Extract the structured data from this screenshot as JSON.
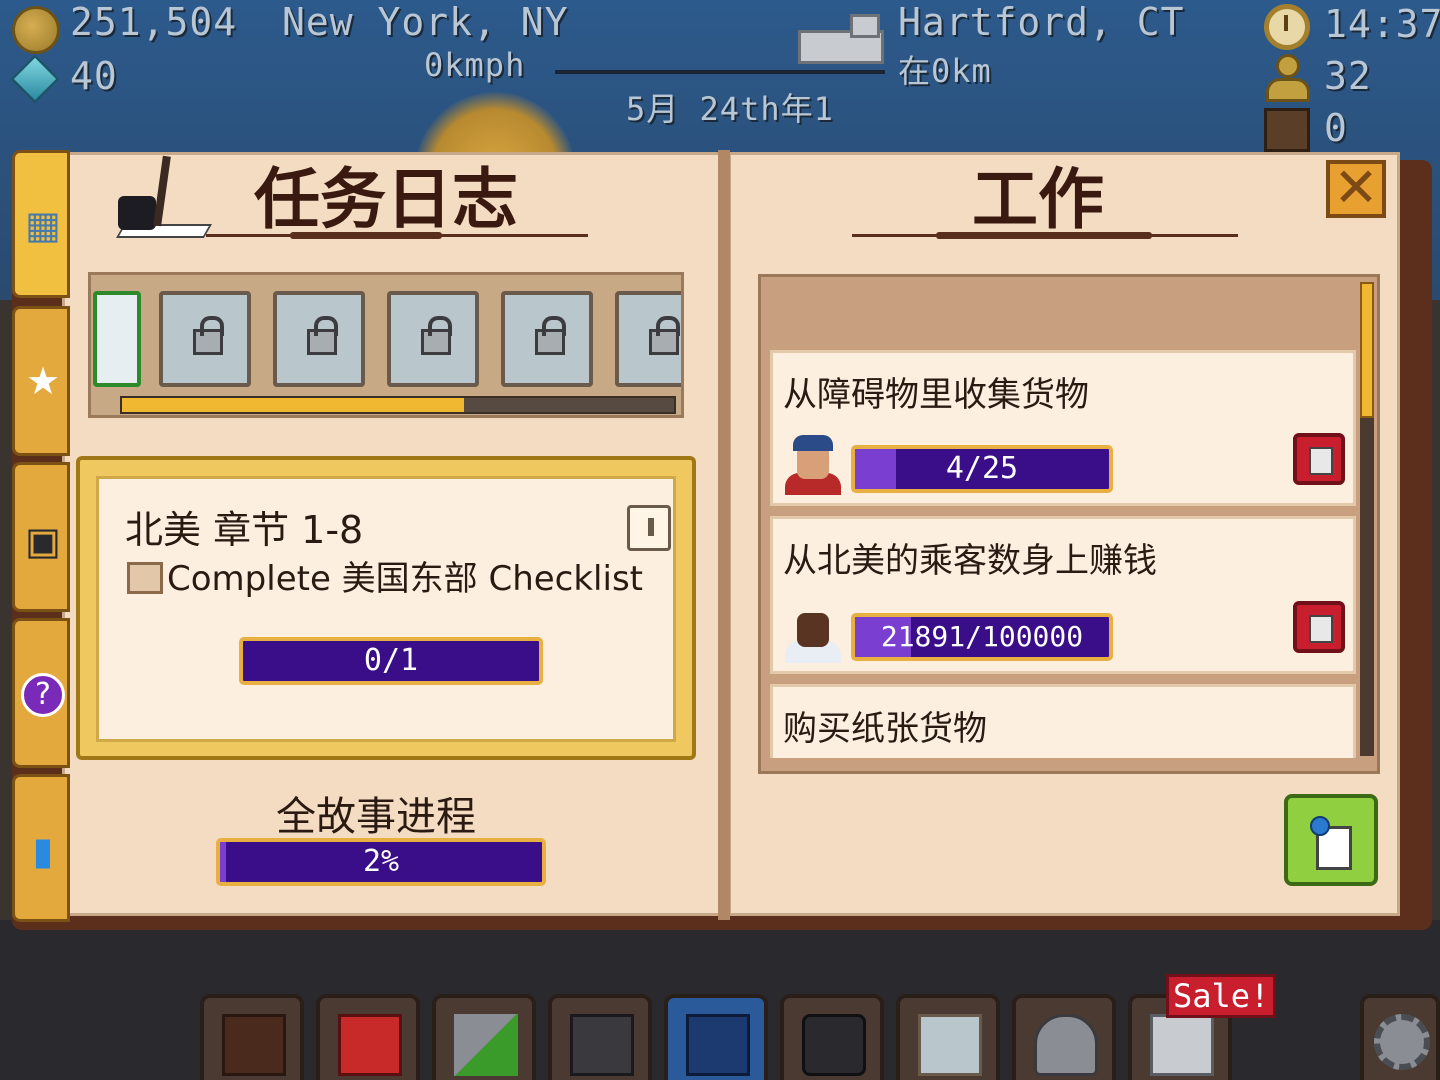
{
  "hud": {
    "coins": "251,504",
    "gems": "40",
    "origin_city": "New York, NY",
    "speed": "0kmph",
    "date": "5月 24th年1",
    "destination_city": "Hartford, CT",
    "distance": "在0km",
    "time": "14:37",
    "passengers": "32",
    "cargo": "0"
  },
  "quest_log": {
    "title": "任务日志",
    "map_progress": 0.62,
    "chapter": {
      "title": "北美 章节 1-8",
      "task": "Complete 美国东部 Checklist",
      "progress_label": "0/1",
      "progress": 0
    },
    "story_label": "全故事进程",
    "story_progress_label": "2%",
    "story_progress": 0.02
  },
  "jobs": {
    "title": "工作",
    "items": [
      {
        "title": "从障碍物里收集货物",
        "progress_label": "4/25",
        "progress": 0.16
      },
      {
        "title": "从北美的乘客数身上赚钱",
        "progress_label": "21891/100000",
        "progress": 0.219
      },
      {
        "title": "购买纸张货物"
      }
    ]
  },
  "bottom_bar": {
    "sale_label": "Sale!"
  },
  "colors": {
    "progress_bg": "#3a0e88",
    "progress_fill": "#7a3ed0",
    "gold": "#f0b830",
    "page": "#f3dcc2"
  },
  "icons": {
    "tabs": [
      "map-icon",
      "star-icon",
      "camera-icon",
      "help-icon",
      "stats-icon"
    ],
    "bottom": [
      "book-icon",
      "station-icon",
      "hammer-upgrade-icon",
      "locomotive-icon",
      "train-shop-icon",
      "camera-icon",
      "map-icon",
      "worker-icon",
      "shop-icon",
      "settings-icon"
    ]
  }
}
